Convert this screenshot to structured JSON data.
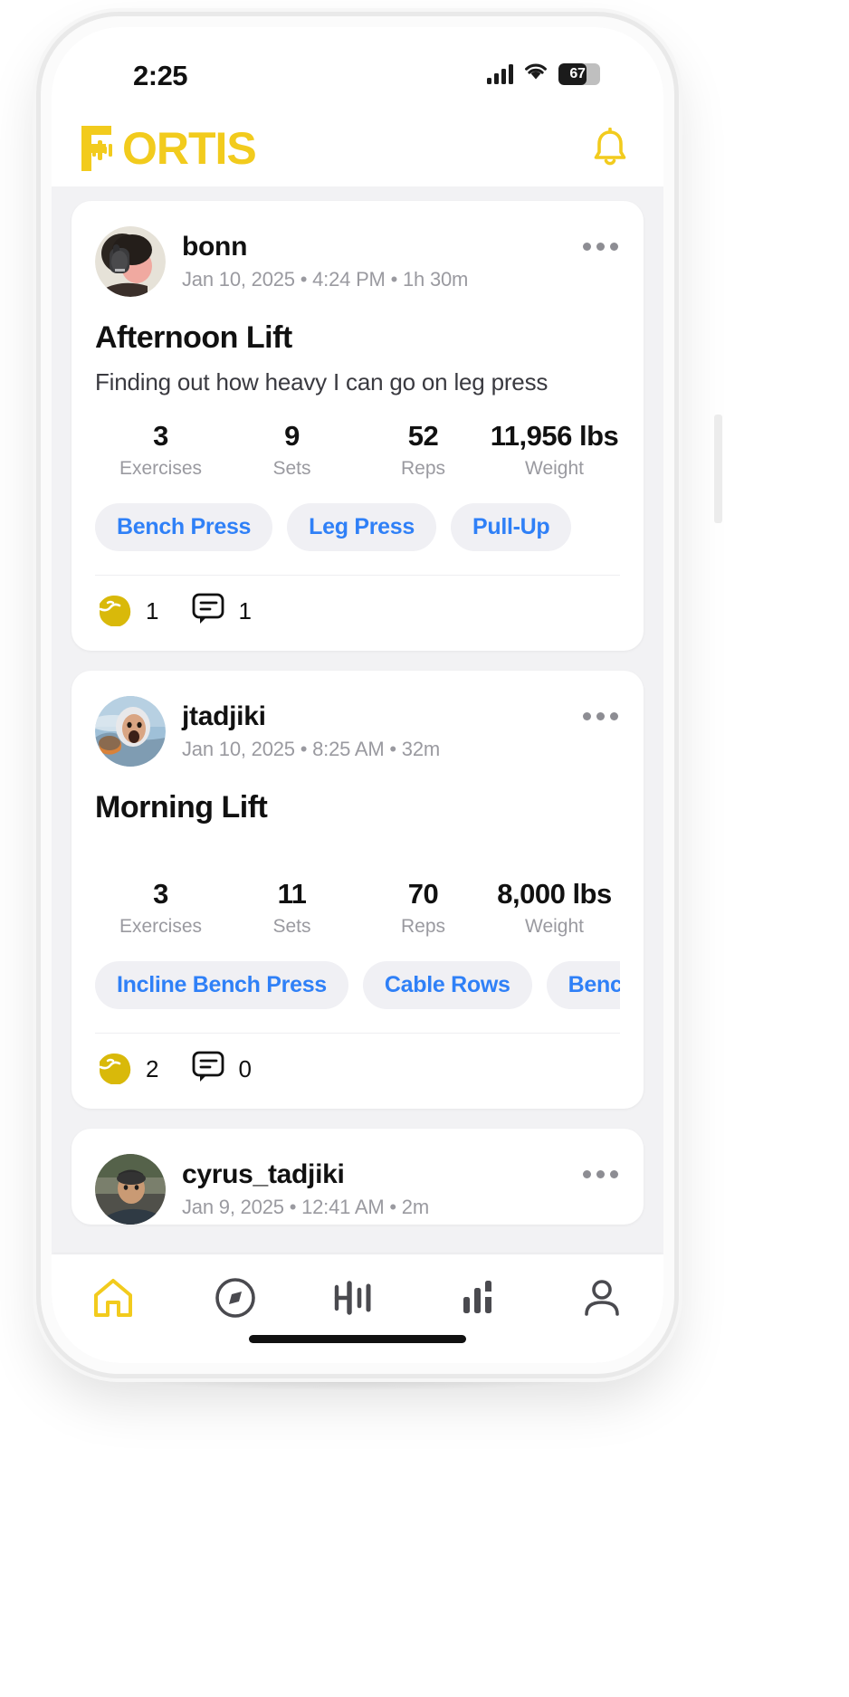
{
  "status_bar": {
    "time": "2:25",
    "battery_percent": "67",
    "signal_icon": "cellular-signal-icon",
    "wifi_icon": "wifi-icon",
    "battery_icon": "battery-icon"
  },
  "header": {
    "brand": "ORTIS",
    "brand_full": "FORTIS",
    "brand_color": "#f2cb1d",
    "bell_icon": "bell-icon"
  },
  "theme": {
    "accent": "#f2cb1d",
    "link": "#2f80f7",
    "background": "#f2f2f4",
    "card": "#ffffff",
    "muted_text": "#9a9aa0"
  },
  "feed": {
    "posts": [
      {
        "username": "bonn",
        "meta": "Jan 10, 2025 • 4:24 PM • 1h 30m",
        "date": "Jan 10, 2025",
        "time": "4:24 PM",
        "duration": "1h 30m",
        "title": "Afternoon Lift",
        "description": "Finding out how heavy I can go on leg press",
        "stats": [
          {
            "value": "3",
            "label": "Exercises"
          },
          {
            "value": "9",
            "label": "Sets"
          },
          {
            "value": "52",
            "label": "Reps"
          },
          {
            "value": "11,956 lbs",
            "label": "Weight"
          }
        ],
        "tags": [
          "Bench Press",
          "Leg Press",
          "Pull-Up"
        ],
        "reactions": {
          "flex_count": "1",
          "comment_count": "1"
        }
      },
      {
        "username": "jtadjiki",
        "meta": "Jan 10, 2025 • 8:25 AM • 32m",
        "date": "Jan 10, 2025",
        "time": "8:25 AM",
        "duration": "32m",
        "title": "Morning Lift",
        "description": "",
        "stats": [
          {
            "value": "3",
            "label": "Exercises"
          },
          {
            "value": "11",
            "label": "Sets"
          },
          {
            "value": "70",
            "label": "Reps"
          },
          {
            "value": "8,000 lbs",
            "label": "Weight"
          }
        ],
        "tags": [
          "Incline Bench Press",
          "Cable Rows",
          "Bench Press"
        ],
        "reactions": {
          "flex_count": "2",
          "comment_count": "0"
        }
      },
      {
        "username": "cyrus_tadjiki",
        "meta": "Jan 9, 2025 • 12:41 AM • 2m",
        "date": "Jan 9, 2025",
        "time": "12:41 AM",
        "duration": "2m",
        "title": "",
        "description": "",
        "stats": [],
        "tags": [],
        "reactions": {
          "flex_count": "",
          "comment_count": ""
        }
      }
    ]
  },
  "bottom_nav": {
    "items": [
      {
        "name": "home",
        "icon": "home-icon",
        "active": true
      },
      {
        "name": "explore",
        "icon": "compass-icon",
        "active": false
      },
      {
        "name": "workout",
        "icon": "barbell-icon",
        "active": false
      },
      {
        "name": "stats",
        "icon": "bar-chart-icon",
        "active": false
      },
      {
        "name": "profile",
        "icon": "person-icon",
        "active": false
      }
    ]
  }
}
